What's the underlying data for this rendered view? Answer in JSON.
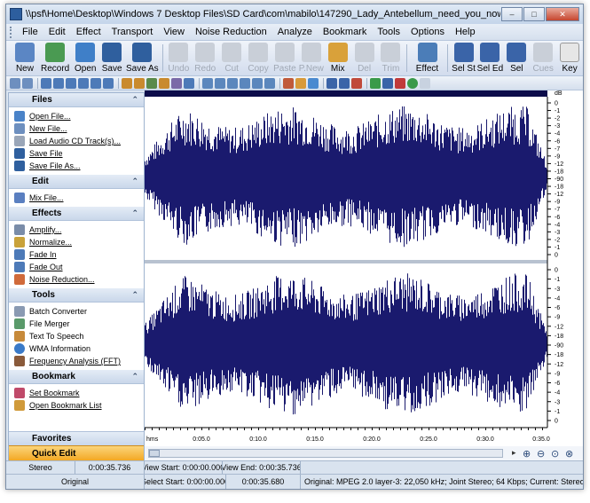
{
  "window": {
    "title": "\\\\psf\\Home\\Desktop\\Windows 7 Desktop Files\\SD Card\\com\\mabilo\\147290_Lady_Antebellum_need_you_now.mp3 - [ MPEG 2.0 layer-3: 22,050 kHz; Joint Ste...",
    "minimize": "–",
    "maximize": "□",
    "close": "✕"
  },
  "menu": [
    {
      "label": "File"
    },
    {
      "label": "Edit"
    },
    {
      "label": "Effect"
    },
    {
      "label": "Transport"
    },
    {
      "label": "View"
    },
    {
      "label": "Noise Reduction"
    },
    {
      "label": "Analyze"
    },
    {
      "label": "Bookmark"
    },
    {
      "label": "Tools"
    },
    {
      "label": "Options"
    },
    {
      "label": "Help"
    }
  ],
  "toolbar": {
    "new": "New",
    "record": "Record",
    "open": "Open",
    "save": "Save",
    "save_as": "Save As",
    "undo": "Undo",
    "redo": "Redo",
    "cut": "Cut",
    "copy": "Copy",
    "paste": "Paste",
    "p_new": "P.New",
    "mix": "Mix",
    "del": "Del",
    "trim": "Trim",
    "effect": "Effect",
    "sel_st": "Sel St",
    "sel_ed": "Sel Ed",
    "sel": "Sel",
    "cues": "Cues",
    "key": "Key"
  },
  "sidebar": {
    "files": {
      "header": "Files",
      "items": [
        "Open File...",
        "New File...",
        "Load Audio CD Track(s)...",
        "Save File",
        "Save File As..."
      ]
    },
    "edit": {
      "header": "Edit",
      "items": [
        "Mix File..."
      ]
    },
    "effects": {
      "header": "Effects",
      "items": [
        "Amplify...",
        "Normalize...",
        "Fade In",
        "Fade Out",
        "Noise Reduction..."
      ]
    },
    "tools": {
      "header": "Tools",
      "items": [
        "Batch Converter",
        "File Merger",
        "Text To Speech",
        "WMA Information",
        "Frequency Analysis (FFT)"
      ]
    },
    "bookmark": {
      "header": "Bookmark",
      "items": [
        "Set Bookmark",
        "Open Bookmark List"
      ]
    },
    "favorites": "Favorites",
    "quick_edit": "Quick Edit"
  },
  "waveform": {
    "db_unit": "dB",
    "db_labels_top": [
      "0",
      "-1",
      "-2",
      "-3",
      "-4",
      "-6",
      "-7",
      "-9",
      "-12",
      "-18",
      "-90",
      "-18",
      "-12",
      "-9",
      "-7",
      "-6",
      "-4",
      "-3",
      "-2",
      "-1",
      "0"
    ],
    "db_labels_bottom": [
      "0",
      "-1",
      "-3",
      "-4",
      "-6",
      "-9",
      "-12",
      "-18",
      "-90",
      "-18",
      "-12",
      "-9",
      "-6",
      "-4",
      "-3",
      "-1",
      "0"
    ],
    "time_labels": [
      "hms",
      "0:05.0",
      "0:10.0",
      "0:15.0",
      "0:20.0",
      "0:25.0",
      "0:30.0",
      "0:35.0"
    ],
    "wave_color": "#1a1a6e"
  },
  "status": {
    "channel": "Stereo",
    "duration": "0:00:35.736",
    "view_start": "View Start: 0:00:00.000",
    "view_end": "View End: 0:00:35.736",
    "original_label": "Original",
    "select_start": "Select Start: 0:00:00.000",
    "select_end": "0:00:35.680",
    "format": "Original: MPEG 2.0 layer-3: 22,050 kHz; Joint Stereo; 64 Kbps;  Current: Stereo,22,050 Hz"
  },
  "colors": {
    "accent": "#2d5e9e",
    "quick_edit": "#f3a824"
  }
}
